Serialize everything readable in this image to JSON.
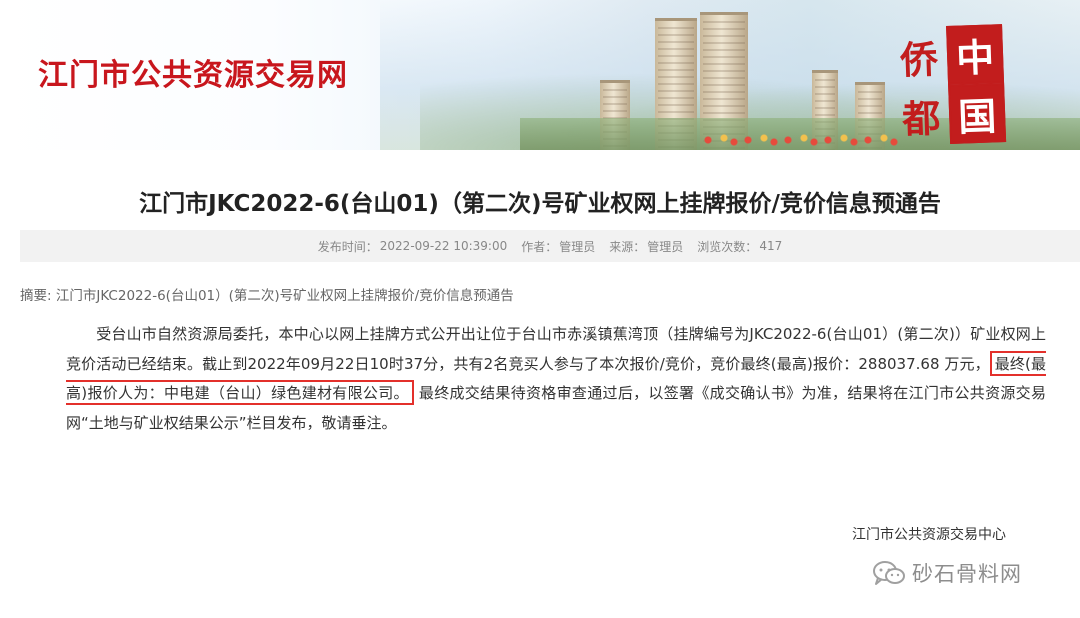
{
  "header": {
    "site_title": "江门市公共资源交易网",
    "seal_chars": [
      "侨",
      "中",
      "都",
      "国"
    ]
  },
  "article": {
    "title": "江门市JKC2022-6(台山01)（第二次)号矿业权网上挂牌报价/竞价信息预通告",
    "meta": {
      "publish_label": "发布时间：",
      "publish_time": "2022-09-22 10:39:00",
      "author_label": "作者：",
      "author": "管理员",
      "source_label": "来源：",
      "source": "管理员",
      "views_label": "浏览次数：",
      "views": "417"
    },
    "summary": "摘要: 江门市JKC2022-6(台山01）(第二次)号矿业权网上挂牌报价/竞价信息预通告",
    "body_part1": "受台山市自然资源局委托，本中心以网上挂牌方式公开出让位于台山市赤溪镇蕉湾顶（挂牌编号为JKC2022-6(台山01）(第二次)）矿业权网上竞价活动已经结束。截止到2022年09月22日10时37分，共有2名竞买人参与了本次报价/竞价，竞价最终(最高)报价：288037.68 万元，",
    "body_highlight": "最终(最高)报价人为：中电建（台山）绿色建材有限公司。",
    "body_part2": "最终成交结果待资格审查通过后，以签署《成交确认书》为准，结果将在江门市公共资源交易网“土地与矿业权结果公示”栏目发布，敬请垂注。",
    "signature": "江门市公共资源交易中心"
  },
  "watermark": {
    "icon": "wechat-icon",
    "text": "砂石骨料网"
  },
  "colors": {
    "brand_red": "#c8161d",
    "highlight_border": "#e3302b",
    "meta_bar_bg": "#f2f2f2"
  }
}
